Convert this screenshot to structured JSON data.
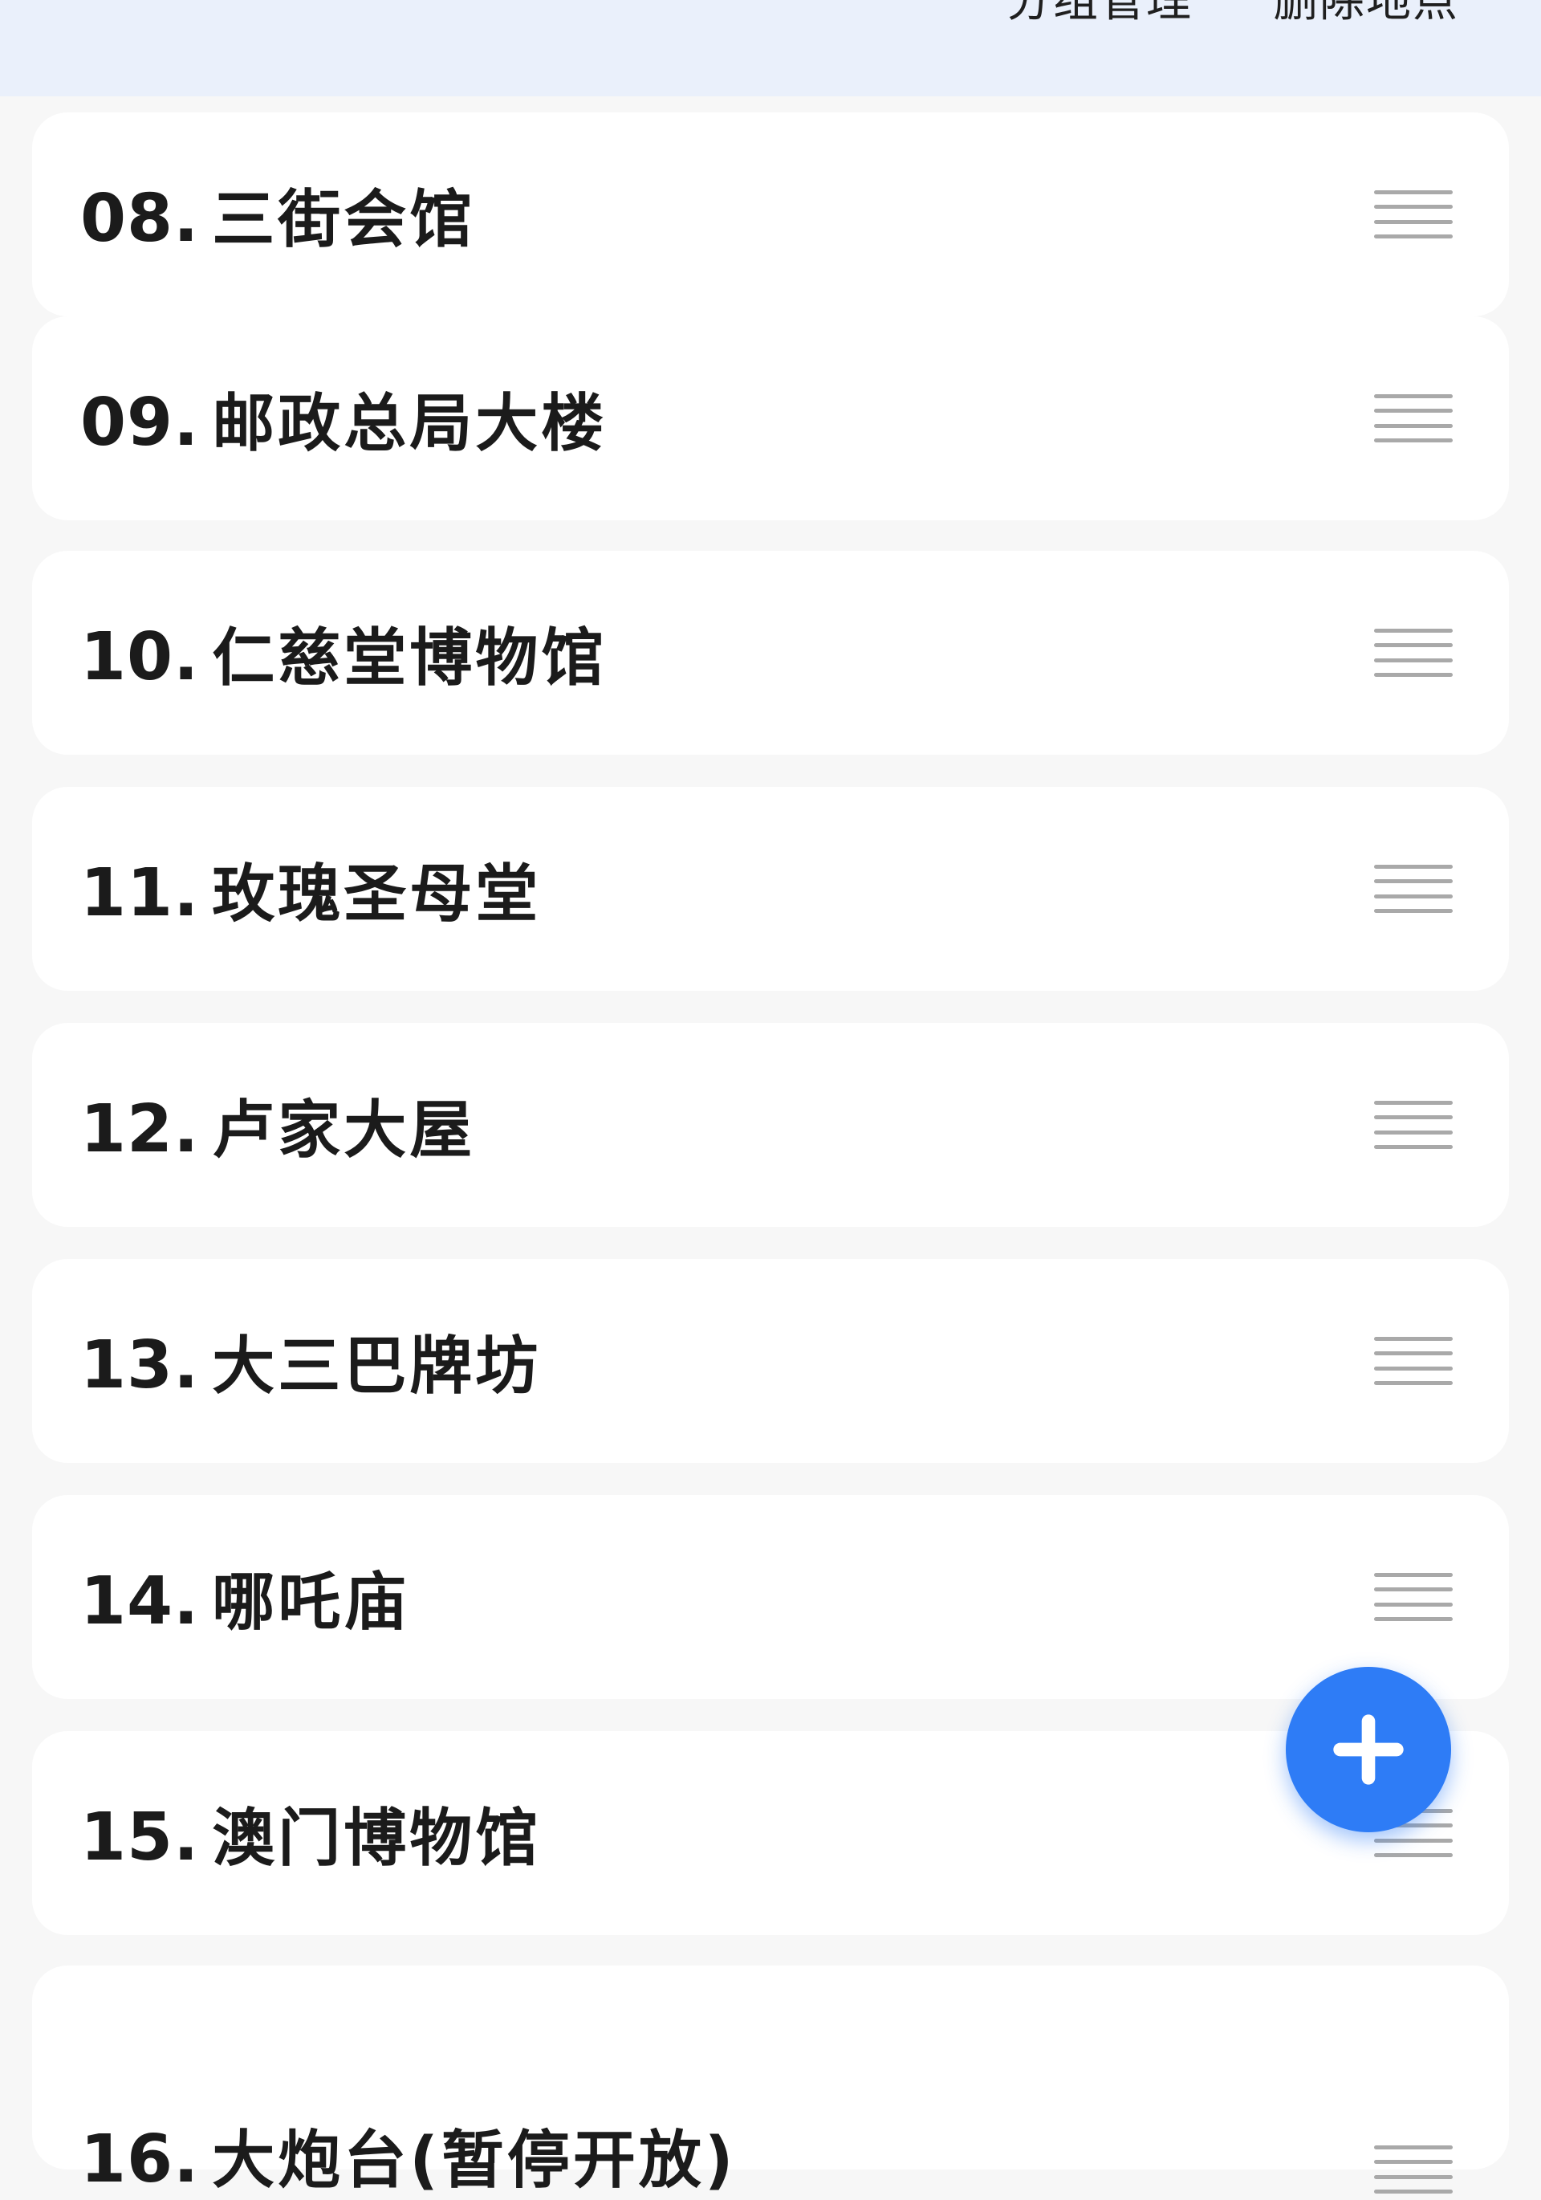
{
  "header": {
    "group_manage_label": "分组管理",
    "delete_places_label": "删除地点"
  },
  "places": [
    {
      "index": "08.",
      "name": "三街会馆"
    },
    {
      "index": "09.",
      "name": "邮政总局大楼"
    },
    {
      "index": "10.",
      "name": "仁慈堂博物馆"
    },
    {
      "index": "11.",
      "name": "玫瑰圣母堂"
    },
    {
      "index": "12.",
      "name": "卢家大屋"
    },
    {
      "index": "13.",
      "name": "大三巴牌坊"
    },
    {
      "index": "14.",
      "name": "哪吒庙"
    },
    {
      "index": "15.",
      "name": "澳门博物馆"
    },
    {
      "index": "16.",
      "name": "大炮台(暂停开放)"
    }
  ],
  "fab": {
    "icon": "plus-icon",
    "color": "#2e7cf6"
  },
  "colors": {
    "header_bg": "#eaf0fb",
    "page_bg": "#f7f7f7",
    "card_bg": "#ffffff",
    "handle": "#a9a9a9"
  }
}
